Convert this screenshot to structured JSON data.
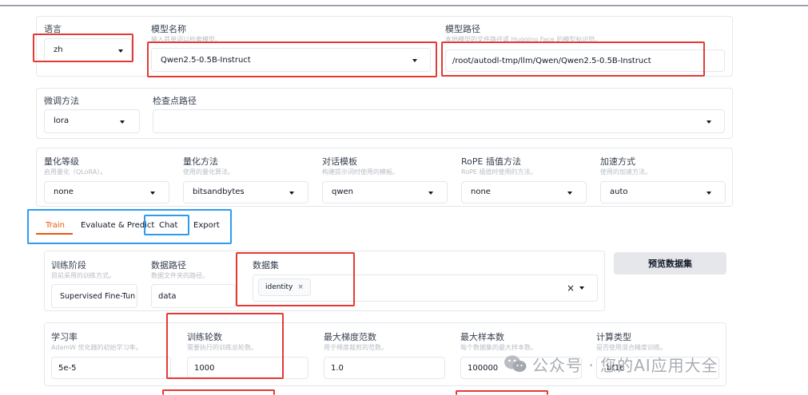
{
  "top": {
    "language": {
      "label": "语言",
      "value": "zh"
    },
    "model_name": {
      "label": "模型名称",
      "hint": "输入首单词以检索模型。",
      "value": "Qwen2.5-0.5B-Instruct"
    },
    "model_path": {
      "label": "模型路径",
      "hint": "本地模型的文件路径或 Hugging Face 的模型标识符。",
      "value": "/root/autodl-tmp/llm/Qwen/Qwen2.5-0.5B-Instruct"
    }
  },
  "finetune": {
    "method": {
      "label": "微调方法",
      "value": "lora"
    },
    "checkpoint": {
      "label": "检查点路径",
      "value": ""
    }
  },
  "quant": {
    "bit": {
      "label": "量化等级",
      "hint": "启用量化（QLoRA）。",
      "value": "none"
    },
    "method": {
      "label": "量化方法",
      "hint": "使用的量化算法。",
      "value": "bitsandbytes"
    },
    "template": {
      "label": "对话模板",
      "hint": "构建提示词时使用的模板。",
      "value": "qwen"
    },
    "rope": {
      "label": "RoPE 插值方法",
      "hint": "RoPE 插值时使用的方法。",
      "value": "none"
    },
    "booster": {
      "label": "加速方式",
      "hint": "使用的加速方法。",
      "value": "auto"
    }
  },
  "tabs": [
    {
      "label": "Train"
    },
    {
      "label": "Evaluate & Predict"
    },
    {
      "label": "Chat"
    },
    {
      "label": "Export"
    }
  ],
  "train": {
    "stage": {
      "label": "训练阶段",
      "hint": "目前采用的训练方式。",
      "value": "Supervised Fine-Tun"
    },
    "dataset_dir": {
      "label": "数据路径",
      "hint": "数据文件夹的路径。",
      "value": "data"
    },
    "dataset": {
      "label": "数据集",
      "chip": "identity",
      "chip_x": "×",
      "clear": "×"
    },
    "preview_button": "预览数据集",
    "lr": {
      "label": "学习率",
      "hint": "AdamW 优化器的初始学习率。",
      "value": "5e-5"
    },
    "epochs": {
      "label": "训练轮数",
      "hint": "需要执行的训练总轮数。",
      "value": "1000"
    },
    "grad_norm": {
      "label": "最大梯度范数",
      "hint": "用于梯度裁剪的范数。",
      "value": "1.0"
    },
    "max_samples": {
      "label": "最大样本数",
      "hint": "每个数据集的最大样本数。",
      "value": "100000"
    },
    "compute_type": {
      "label": "计算类型",
      "hint": "是否使用混合精度训练。",
      "value": "bf16"
    }
  },
  "watermark": {
    "text": "公众号 · 您的AI应用大全"
  },
  "colors": {
    "annotation_red": "#e53935",
    "annotation_blue": "#2e9bf0",
    "active_tab": "#ea580c"
  }
}
